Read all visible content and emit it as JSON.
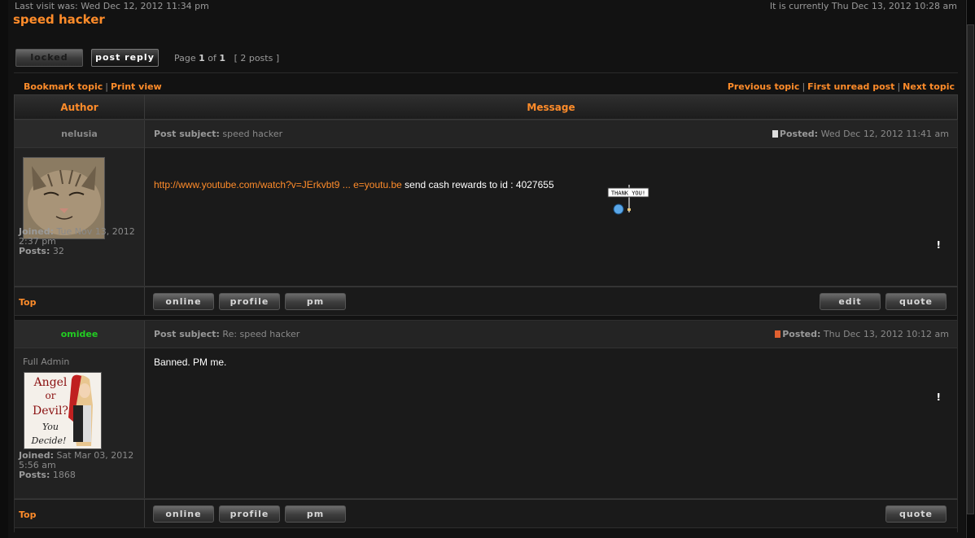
{
  "header": {
    "last_visit": "Last visit was: Wed Dec 12, 2012 11:34 pm",
    "current_time": "It is currently Thu Dec 13, 2012 10:28 am",
    "topic_title": "speed hacker"
  },
  "controls": {
    "locked_label": "locked",
    "post_reply_label": "post reply",
    "page_prefix": "Page",
    "page_current": "1",
    "page_of": "of",
    "page_total": "1",
    "post_count": "[ 2 posts ]"
  },
  "nav": {
    "bookmark": "Bookmark topic",
    "print": "Print view",
    "previous": "Previous topic",
    "first_unread": "First unread post",
    "next": "Next topic",
    "separator": "|"
  },
  "table": {
    "author_header": "Author",
    "message_header": "Message"
  },
  "posts": [
    {
      "author": "nelusia",
      "author_color": "#8a8a8a",
      "subject_label": "Post subject:",
      "subject": "speed hacker",
      "posted_label": "Posted:",
      "posted": "Wed Dec 12, 2012 11:41 am",
      "link_text": "http://www.youtube.com/watch?v=JErkvbt9 ... e=youtu.be",
      "body": " send cash rewards to id : 4027655",
      "smiley_text": "THANK YOU!",
      "bang": "!",
      "joined_label": "Joined:",
      "joined": "Tue Nov 13, 2012 2:37 pm",
      "posts_label": "Posts:",
      "posts": "32",
      "top": "Top",
      "buttons": [
        "online",
        "profile",
        "pm"
      ],
      "right_buttons": [
        "edit",
        "quote"
      ]
    },
    {
      "author": "omidee",
      "author_color": "#22cc22",
      "rank": "Full Admin",
      "subject_label": "Post subject:",
      "subject": "Re: speed hacker",
      "posted_label": "Posted:",
      "posted": "Thu Dec 13, 2012 10:12 am",
      "body": "Banned. PM me.",
      "bang": "!",
      "avatar_text": [
        "Angel",
        "or",
        "Devil?",
        "You",
        "Decide!"
      ],
      "joined_label": "Joined:",
      "joined": "Sat Mar 03, 2012 5:56 am",
      "posts_label": "Posts:",
      "posts": "1868",
      "top": "Top",
      "buttons": [
        "online",
        "profile",
        "pm"
      ],
      "right_buttons": [
        "quote"
      ]
    }
  ],
  "colors": {
    "accent": "#ff8c2a",
    "background": "#121212",
    "admin_name": "#22cc22"
  }
}
